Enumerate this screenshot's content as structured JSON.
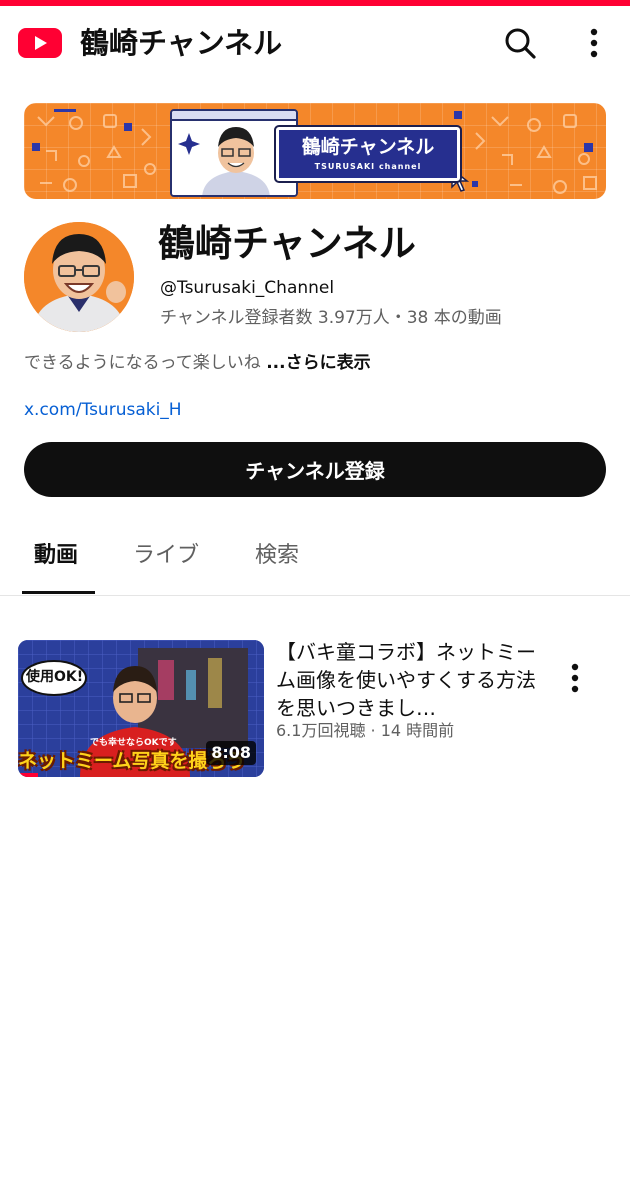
{
  "app": {
    "title": "鶴崎チャンネル"
  },
  "banner": {
    "title": "鶴崎チャンネル",
    "subtitle": "TSURUSAKI channel"
  },
  "channel": {
    "name": "鶴崎チャンネル",
    "handle": "@Tsurusaki_Channel",
    "meta": "チャンネル登録者数 3.97万人・38 本の動画",
    "description": "できるようになるって楽しいね",
    "description_more": "...さらに表示",
    "link": "x.com/Tsurusaki_H"
  },
  "subscribe_label": "チャンネル登録",
  "tabs": [
    {
      "label": "動画",
      "active": true
    },
    {
      "label": "ライブ",
      "active": false
    },
    {
      "label": "検索",
      "active": false
    }
  ],
  "videos": [
    {
      "title": "【バキ童コラボ】ネットミーム画像を使いやすくする方法を思いつきまし…",
      "meta": "6.1万回視聴 · 14 時間前",
      "duration": "8:08",
      "thumb_badge": "使用OK!",
      "thumb_caption_small": "でも幸せならOKです",
      "thumb_caption": "ネットミーム写真を撮ろう",
      "watched_fraction": 0.08
    }
  ],
  "colors": {
    "accent": "#ff0033",
    "banner_bg": "#f4872a",
    "banner_box": "#262f8f",
    "link": "#065fd4",
    "subscribe_bg": "#0f0f0f"
  },
  "icons": [
    "youtube-logo-icon",
    "search-icon",
    "more-vert-icon"
  ]
}
